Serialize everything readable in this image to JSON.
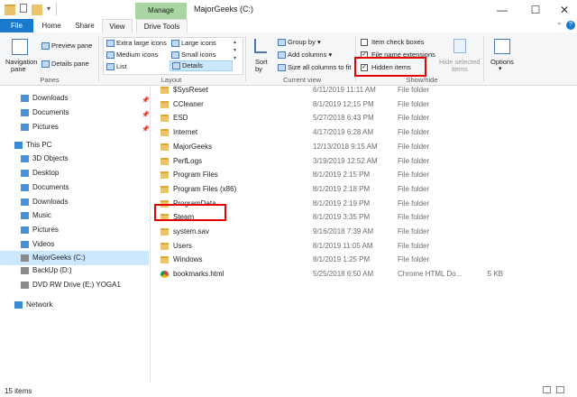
{
  "window": {
    "title": "MajorGeeks (C:)",
    "contextual_tab": "Manage",
    "controls": {
      "minimize": "—",
      "maximize": "☐",
      "close": "✕"
    }
  },
  "tabs": [
    "File",
    "Home",
    "Share",
    "View",
    "Drive Tools"
  ],
  "ribbon": {
    "panes": {
      "navigation_pane": "Navigation",
      "navigation_pane_sub": "pane",
      "preview_pane": "Preview pane",
      "details_pane": "Details pane",
      "label": "Panes"
    },
    "layout": {
      "options": [
        "Extra large icons",
        "Large icons",
        "Medium icons",
        "Small icons",
        "List",
        "Details"
      ],
      "selected": "Details",
      "label": "Layout"
    },
    "current_view": {
      "sort_by": "Sort",
      "sort_by_sub": "by",
      "group_by": "Group by",
      "add_columns": "Add columns",
      "size_columns": "Size all columns to fit",
      "label": "Current view"
    },
    "show_hide": {
      "item_check_boxes": "Item check boxes",
      "file_name_extensions": "File name extensions",
      "hidden_items": "Hidden items",
      "hide_selected_items": "Hide selected",
      "hide_selected_items_2": "items",
      "label": "Show/hide",
      "checked": {
        "item_check_boxes": false,
        "file_name_extensions": true,
        "hidden_items": true
      }
    },
    "options": "Options"
  },
  "nav_pane": {
    "items": [
      {
        "label": "Downloads",
        "icon": "download-icon",
        "pinned": true,
        "indent": 1
      },
      {
        "label": "Documents",
        "icon": "documents-icon",
        "pinned": true,
        "indent": 1
      },
      {
        "label": "Pictures",
        "icon": "pictures-icon",
        "pinned": true,
        "indent": 1
      },
      {
        "label": "This PC",
        "icon": "computer-icon",
        "pinned": false,
        "indent": 0
      },
      {
        "label": "3D Objects",
        "icon": "cube-icon",
        "pinned": false,
        "indent": 1
      },
      {
        "label": "Desktop",
        "icon": "desktop-icon",
        "pinned": false,
        "indent": 1
      },
      {
        "label": "Documents",
        "icon": "documents-icon",
        "pinned": false,
        "indent": 1
      },
      {
        "label": "Downloads",
        "icon": "download-icon",
        "pinned": false,
        "indent": 1
      },
      {
        "label": "Music",
        "icon": "music-icon",
        "pinned": false,
        "indent": 1
      },
      {
        "label": "Pictures",
        "icon": "pictures-icon",
        "pinned": false,
        "indent": 1
      },
      {
        "label": "Videos",
        "icon": "videos-icon",
        "pinned": false,
        "indent": 1
      },
      {
        "label": "MajorGeeks (C:)",
        "icon": "drive-icon",
        "pinned": false,
        "indent": 1,
        "selected": true
      },
      {
        "label": "BackUp (D:)",
        "icon": "drive-icon",
        "pinned": false,
        "indent": 1
      },
      {
        "label": "DVD RW Drive (E:) YOGA1",
        "icon": "disc-icon",
        "pinned": false,
        "indent": 1
      },
      {
        "label": "Network",
        "icon": "network-icon",
        "pinned": false,
        "indent": 0
      }
    ]
  },
  "files": [
    {
      "name": "$SysReset",
      "date": "6/11/2019 11:11 AM",
      "type": "File folder",
      "size": "",
      "icon": "folder-icon"
    },
    {
      "name": "CCleaner",
      "date": "8/1/2019 12:15 PM",
      "type": "File folder",
      "size": "",
      "icon": "folder-icon"
    },
    {
      "name": "ESD",
      "date": "5/27/2018 6:43 PM",
      "type": "File folder",
      "size": "",
      "icon": "folder-icon"
    },
    {
      "name": "Internet",
      "date": "4/17/2019 6:28 AM",
      "type": "File folder",
      "size": "",
      "icon": "folder-icon"
    },
    {
      "name": "MajorGeeks",
      "date": "12/13/2018 9:15 AM",
      "type": "File folder",
      "size": "",
      "icon": "folder-icon"
    },
    {
      "name": "PerfLogs",
      "date": "3/19/2019 12:52 AM",
      "type": "File folder",
      "size": "",
      "icon": "folder-icon"
    },
    {
      "name": "Program Files",
      "date": "8/1/2019 2:15 PM",
      "type": "File folder",
      "size": "",
      "icon": "folder-icon"
    },
    {
      "name": "Program Files (x86)",
      "date": "8/1/2019 2:18 PM",
      "type": "File folder",
      "size": "",
      "icon": "folder-icon"
    },
    {
      "name": "ProgramData",
      "date": "8/1/2019 2:19 PM",
      "type": "File folder",
      "size": "",
      "icon": "folder-icon"
    },
    {
      "name": "Steam",
      "date": "8/1/2019 3:35 PM",
      "type": "File folder",
      "size": "",
      "icon": "folder-icon"
    },
    {
      "name": "system.sav",
      "date": "9/16/2018 7:39 AM",
      "type": "File folder",
      "size": "",
      "icon": "folder-icon"
    },
    {
      "name": "Users",
      "date": "8/1/2019 11:05 AM",
      "type": "File folder",
      "size": "",
      "icon": "folder-icon"
    },
    {
      "name": "Windows",
      "date": "8/1/2019 1:25 PM",
      "type": "File folder",
      "size": "",
      "icon": "folder-icon"
    },
    {
      "name": "bookmarks.html",
      "date": "5/25/2018 6:50 AM",
      "type": "Chrome HTML Do...",
      "size": "5 KB",
      "icon": "chrome-icon"
    }
  ],
  "status": {
    "count": "15 items"
  },
  "highlight_color": "#e60000"
}
